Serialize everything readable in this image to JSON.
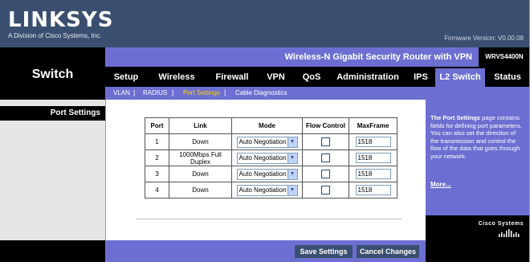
{
  "brand": {
    "logo": "LINKSYS",
    "tagline": "A Division of Cisco Systems, Inc.",
    "firmware": "Firmware Version: V0.00.08"
  },
  "product": {
    "name": "Wireless-N Gigabit Security Router with VPN",
    "model": "WRVS4400N"
  },
  "section_title": "Switch",
  "tabs": [
    {
      "label": "Setup"
    },
    {
      "label": "Wireless"
    },
    {
      "label": "Firewall"
    },
    {
      "label": "VPN"
    },
    {
      "label": "QoS"
    },
    {
      "label": "Administration"
    },
    {
      "label": "IPS"
    },
    {
      "label": "L2 Switch"
    },
    {
      "label": "Status"
    }
  ],
  "subtabs": [
    {
      "label": "VLAN"
    },
    {
      "label": "RADIUS"
    },
    {
      "label": "Port Settings"
    },
    {
      "label": "Cable Diagnostics"
    }
  ],
  "left_heading": "Port Settings",
  "table": {
    "headers": [
      "Port",
      "Link",
      "Mode",
      "Flow Control",
      "MaxFrame"
    ],
    "rows": [
      {
        "port": "1",
        "link": "Down",
        "mode": "Auto Negotiation",
        "flow_control": false,
        "maxframe": "1518"
      },
      {
        "port": "2",
        "link": "1000Mbps Full Duplex",
        "mode": "Auto Negotiation",
        "flow_control": false,
        "maxframe": "1518"
      },
      {
        "port": "3",
        "link": "Down",
        "mode": "Auto Negotiation",
        "flow_control": false,
        "maxframe": "1518"
      },
      {
        "port": "4",
        "link": "Down",
        "mode": "Auto Negotiation",
        "flow_control": false,
        "maxframe": "1518"
      }
    ]
  },
  "help": {
    "title": "The Port Settings",
    "body": " page contains fields for defining port parameters. You can also set the direction of the transmission and control the flow of the data that goes through your network.",
    "more_label": "More..."
  },
  "cisco_logo": "Cisco Systems",
  "buttons": {
    "save": "Save Settings",
    "cancel": "Cancel Changes"
  },
  "colors": {
    "accent": "#6c6fd1",
    "header": "#3a4f70",
    "active_subtab": "#ffd200"
  }
}
